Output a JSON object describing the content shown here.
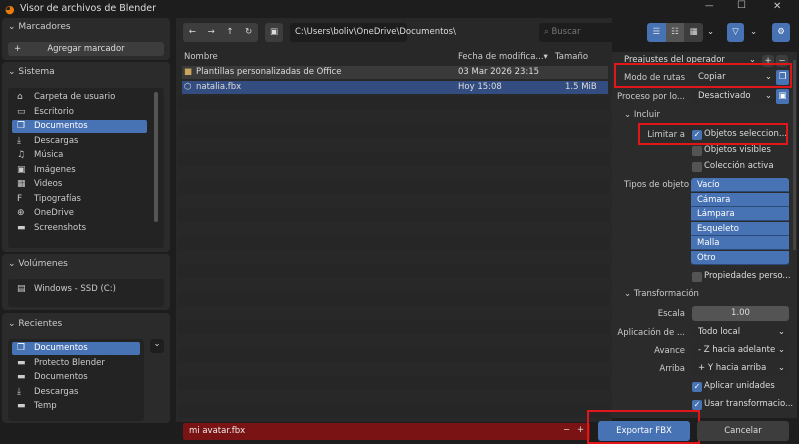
{
  "window": {
    "title": "Visor de archivos de Blender",
    "minimize": "—",
    "maximize": "☐",
    "close": "✕"
  },
  "sidebar": {
    "bookmarks": {
      "title": "Marcadores",
      "add_label": "Agregar marcador"
    },
    "system": {
      "title": "Sistema",
      "items": [
        {
          "label": "Carpeta de usuario",
          "icon": "⌂"
        },
        {
          "label": "Escritorio",
          "icon": "▭"
        },
        {
          "label": "Documentos",
          "icon": "❐"
        },
        {
          "label": "Descargas",
          "icon": "⤓"
        },
        {
          "label": "Música",
          "icon": "♫"
        },
        {
          "label": "Imágenes",
          "icon": "▣"
        },
        {
          "label": "Videos",
          "icon": "▦"
        },
        {
          "label": "Tipografías",
          "icon": "F"
        },
        {
          "label": "OneDrive",
          "icon": "⊕"
        },
        {
          "label": "Screenshots",
          "icon": "▬"
        }
      ]
    },
    "volumes": {
      "title": "Volúmenes",
      "items": [
        {
          "label": "Windows - SSD (C:)"
        }
      ]
    },
    "recent": {
      "title": "Recientes",
      "items": [
        {
          "label": "Documentos",
          "icon": "❐"
        },
        {
          "label": "Protecto Blender",
          "icon": "▬"
        },
        {
          "label": "Documentos",
          "icon": "▬"
        },
        {
          "label": "Descargas",
          "icon": "⤓"
        },
        {
          "label": "Temp",
          "icon": "▬"
        }
      ]
    }
  },
  "toolbar": {
    "path": "C:\\Users\\boliv\\OneDrive\\Documentos\\",
    "search_placeholder": "Buscar"
  },
  "files": {
    "columns": {
      "name": "Nombre",
      "date": "Fecha de modifica...",
      "size": "Tamaño"
    },
    "rows": [
      {
        "name": "Plantillas personalizadas de Office",
        "date": "03 Mar 2026 23:15",
        "size": "",
        "type": "folder"
      },
      {
        "name": "natalia.fbx",
        "date": "Hoy 15:08",
        "size": "1.5 MiB",
        "type": "fbx"
      }
    ]
  },
  "filename": "mi avatar.fbx",
  "options": {
    "presets": "Preajustes del operador",
    "path_mode_label": "Modo de rutas",
    "path_mode": "Copiar",
    "batch_label": "Proceso por lo...",
    "batch": "Desactivado",
    "include": {
      "title": "Incluir",
      "limit_label": "Limitar a",
      "selected": "Objetos seleccion...",
      "visible": "Objetos visibles",
      "active_collection": "Colección activa",
      "types_label": "Tipos de objeto",
      "types": [
        "Vacío",
        "Cámara",
        "Lámpara",
        "Esqueleto",
        "Malla",
        "Otro"
      ],
      "custom_props": "Propiedades perso..."
    },
    "transform": {
      "title": "Transformación",
      "scale_label": "Escala",
      "scale": "1.00",
      "apply_label": "Aplicación de ...",
      "apply": "Todo local",
      "forward_label": "Avance",
      "forward": "- Z hacia adelante",
      "up_label": "Arriba",
      "up": "+ Y hacia arriba",
      "apply_units": "Aplicar unidades",
      "use_transform": "Usar transformacio..."
    }
  },
  "actions": {
    "export": "Exportar FBX",
    "cancel": "Cancelar"
  }
}
